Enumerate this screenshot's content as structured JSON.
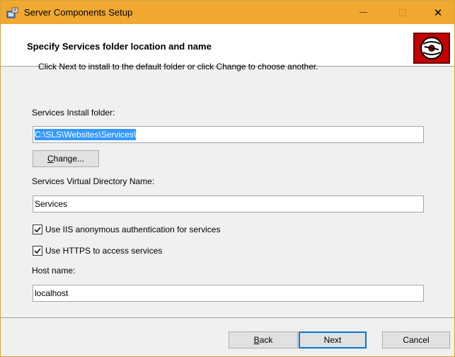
{
  "window": {
    "title": "Server Components Setup",
    "close_glyph": "✕"
  },
  "banner": {
    "title": "Specify Services folder location and name",
    "subtitle": "Click Next to install to the default folder or click Change to choose another.",
    "logo_icon": "disc-icon"
  },
  "form": {
    "install_folder_label": "Services Install folder:",
    "install_folder_value": "C:\\SLS\\Websites\\Services\\",
    "change_button": {
      "accel": "C",
      "rest": "hange..."
    },
    "vdir_label": "Services Virtual Directory Name:",
    "vdir_value": "Services",
    "iis_anon_label": "Use IIS anonymous authentication for services",
    "iis_anon_checked": true,
    "https_label": "Use HTTPS to access services",
    "https_checked": true,
    "host_label": "Host name:",
    "host_value": "localhost"
  },
  "footer": {
    "back_button": {
      "accel": "B",
      "rest": "ack"
    },
    "next_button": "Next",
    "cancel_button": "Cancel"
  },
  "colors": {
    "titlebar": "#f0a830",
    "selection": "#3399ff",
    "logo_bg": "#c40000",
    "default_button_border": "#0078d7"
  }
}
